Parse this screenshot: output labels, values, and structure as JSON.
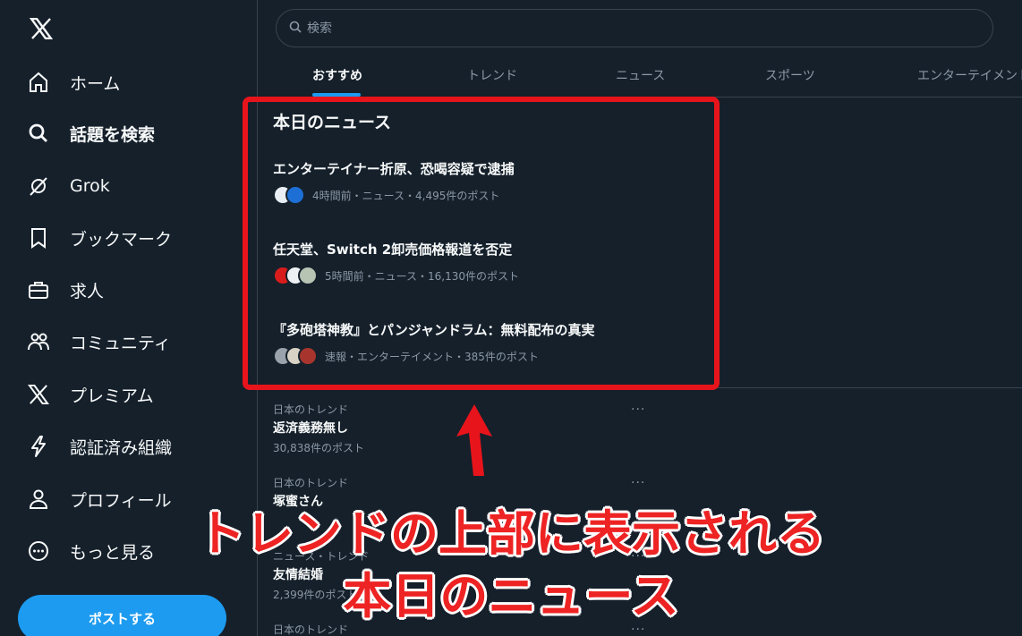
{
  "sidebar": {
    "logo_icon": "x-logo-icon",
    "items": [
      {
        "label": "ホーム",
        "icon": "home-icon"
      },
      {
        "label": "話題を検索",
        "icon": "search-icon",
        "active": true
      },
      {
        "label": "Grok",
        "icon": "grok-icon"
      },
      {
        "label": "ブックマーク",
        "icon": "bookmark-icon"
      },
      {
        "label": "求人",
        "icon": "briefcase-icon"
      },
      {
        "label": "コミュニティ",
        "icon": "communities-icon"
      },
      {
        "label": "プレミアム",
        "icon": "x-premium-icon"
      },
      {
        "label": "認証済み組織",
        "icon": "lightning-icon"
      },
      {
        "label": "プロフィール",
        "icon": "profile-icon"
      },
      {
        "label": "もっと見る",
        "icon": "more-circle-icon"
      }
    ],
    "post_button": "ポストする"
  },
  "search": {
    "placeholder": "検索"
  },
  "tabs": [
    {
      "label": "おすすめ",
      "active": true
    },
    {
      "label": "トレンド"
    },
    {
      "label": "ニュース"
    },
    {
      "label": "スポーツ"
    },
    {
      "label": "エンターテイメント"
    }
  ],
  "news": {
    "heading": "本日のニュース",
    "items": [
      {
        "title": "エンターテイナー折原、恐喝容疑で逮捕",
        "meta": "4時間前・ニュース・4,495件のポスト"
      },
      {
        "title": "任天堂、Switch 2卸売価格報道を否定",
        "meta": "5時間前・ニュース・16,130件のポスト"
      },
      {
        "title": "『多砲塔神教』とパンジャンドラム：無料配布の真実",
        "meta": "速報・エンターテイメント・385件のポスト"
      }
    ]
  },
  "trends": [
    {
      "context": "日本のトレンド",
      "name": "返済義務無し",
      "count": "30,838件のポスト"
    },
    {
      "context": "日本のトレンド",
      "name": "塚蜜さん",
      "count": ""
    },
    {
      "context": "ニュース・トレンド",
      "name": "友情結婚",
      "count": "2,399件のポスト"
    },
    {
      "context": "日本のトレンド",
      "name": "",
      "count": ""
    }
  ],
  "more_label": "···",
  "annotation": {
    "line1": "トレンドの上部に表示される",
    "line2": "本日のニュース"
  },
  "colors": {
    "background": "#15202b",
    "accent": "#1d9bf0",
    "highlight": "#e8141b"
  }
}
